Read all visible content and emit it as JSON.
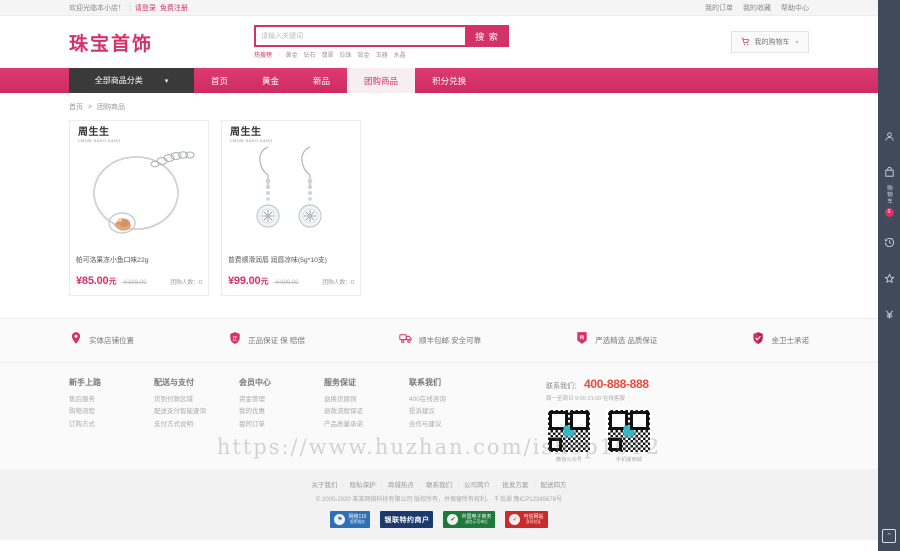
{
  "topbar": {
    "welcome": "欢迎光临本小店！",
    "login": "请登录",
    "register": "免费注册",
    "right_links": [
      "我的订单",
      "我的收藏",
      "帮助中心"
    ]
  },
  "header": {
    "logo": "珠宝首饰",
    "search": {
      "placeholder": "请输入关键词",
      "button": "搜 索",
      "hot_label": "热搜榜",
      "hot_words": [
        "黄金",
        "钻石",
        "翡翠",
        "珍珠",
        "铂金",
        "玉器",
        "水晶"
      ]
    },
    "cart": {
      "label": "我的购物车",
      "icon": "cart-icon",
      "caret": "▾"
    }
  },
  "nav": {
    "category_label": "全部商品分类",
    "caret": "▾",
    "items": [
      {
        "label": "首页",
        "active": false
      },
      {
        "label": "黄金",
        "active": false
      },
      {
        "label": "新品",
        "active": false
      },
      {
        "label": "团购商品",
        "active": true
      },
      {
        "label": "积分兑换",
        "active": false
      }
    ]
  },
  "breadcrumb": {
    "home": "首页",
    "separator": ">",
    "current": "团购商品"
  },
  "products": [
    {
      "brand": "周生生",
      "brand_sub": "CHOW SANG SANG",
      "title": "帕可洛果冻小鱼口味22g",
      "price": "¥85.00",
      "price_unit": "元",
      "old_price": "￥888.00",
      "buyers_label": "团购人数",
      "buyers": "0",
      "image": "bracelet"
    },
    {
      "brand": "周生生",
      "brand_sub": "CHOW SANG SANG",
      "title": "普费顺滑润唇 润唇凉味(5g*10支)",
      "price": "¥99.00",
      "price_unit": "元",
      "old_price": "￥999.00",
      "buyers_label": "团购人数",
      "buyers": "0",
      "image": "earrings"
    }
  ],
  "services": [
    {
      "icon": "location-pin-icon",
      "label": "实体店铺位置"
    },
    {
      "icon": "authentic-shield-icon",
      "label": "正品保证 保 赔偿"
    },
    {
      "icon": "truck-icon",
      "label": "顺丰包邮 安全可靠"
    },
    {
      "icon": "quality-badge-icon",
      "label": "严选精选 品质保证"
    },
    {
      "icon": "guard-shield-icon",
      "label": "金卫士承诺"
    }
  ],
  "footer_columns": [
    {
      "title": "新手上路",
      "links": [
        "售后服务",
        "购物流程",
        "订购方式"
      ]
    },
    {
      "title": "配送与支付",
      "links": [
        "货到付款区域",
        "配送支付智能查询",
        "支付方式说明"
      ]
    },
    {
      "title": "会员中心",
      "links": [
        "资金管理",
        "我的优惠",
        "我的订单"
      ]
    },
    {
      "title": "服务保证",
      "links": [
        "退换货原则",
        "退款流程保证",
        "产品质量承诺"
      ]
    },
    {
      "title": "联系我们",
      "links": [
        "400在线咨询",
        "投诉建议",
        "合作与建议"
      ]
    }
  ],
  "contact": {
    "label": "联系我们：",
    "phone": "400-888-888",
    "hours": "周一至周日 9:00-21:00 在线客服",
    "qrs": [
      {
        "caption": "微信公众号"
      },
      {
        "caption": "手机版商城"
      }
    ]
  },
  "watermark": "https://www.huzhan.com/ishop1012",
  "bottom": {
    "links": [
      "关于我们",
      "隐私保护",
      "商城热点",
      "联系我们",
      "公司简介",
      "批发方案",
      "配送四方"
    ],
    "copyright": "© 2005-2020 某某网络科技有限公司 版权所有，并保留所有权利。 千岛湖 豫ICP12345678号",
    "badges": [
      {
        "type": "blue",
        "line1": "网络110",
        "line2": "报警服务"
      },
      {
        "type": "navy",
        "text": "银联特约商户"
      },
      {
        "type": "green",
        "line1": "中国电子商务",
        "line2": "诚信示范单位"
      },
      {
        "type": "red",
        "line1": "可信网站",
        "line2": "身份验证"
      }
    ]
  },
  "rail": {
    "items": [
      {
        "icon": "user-icon",
        "name": "user"
      },
      {
        "icon": "cart-icon",
        "name": "cart",
        "vtext": "购物车",
        "badge": "0"
      },
      {
        "icon": "history-icon",
        "name": "history"
      },
      {
        "icon": "star-icon",
        "name": "favorites"
      },
      {
        "icon": "yen-icon",
        "name": "price"
      }
    ],
    "back_to_top": "⌃"
  }
}
